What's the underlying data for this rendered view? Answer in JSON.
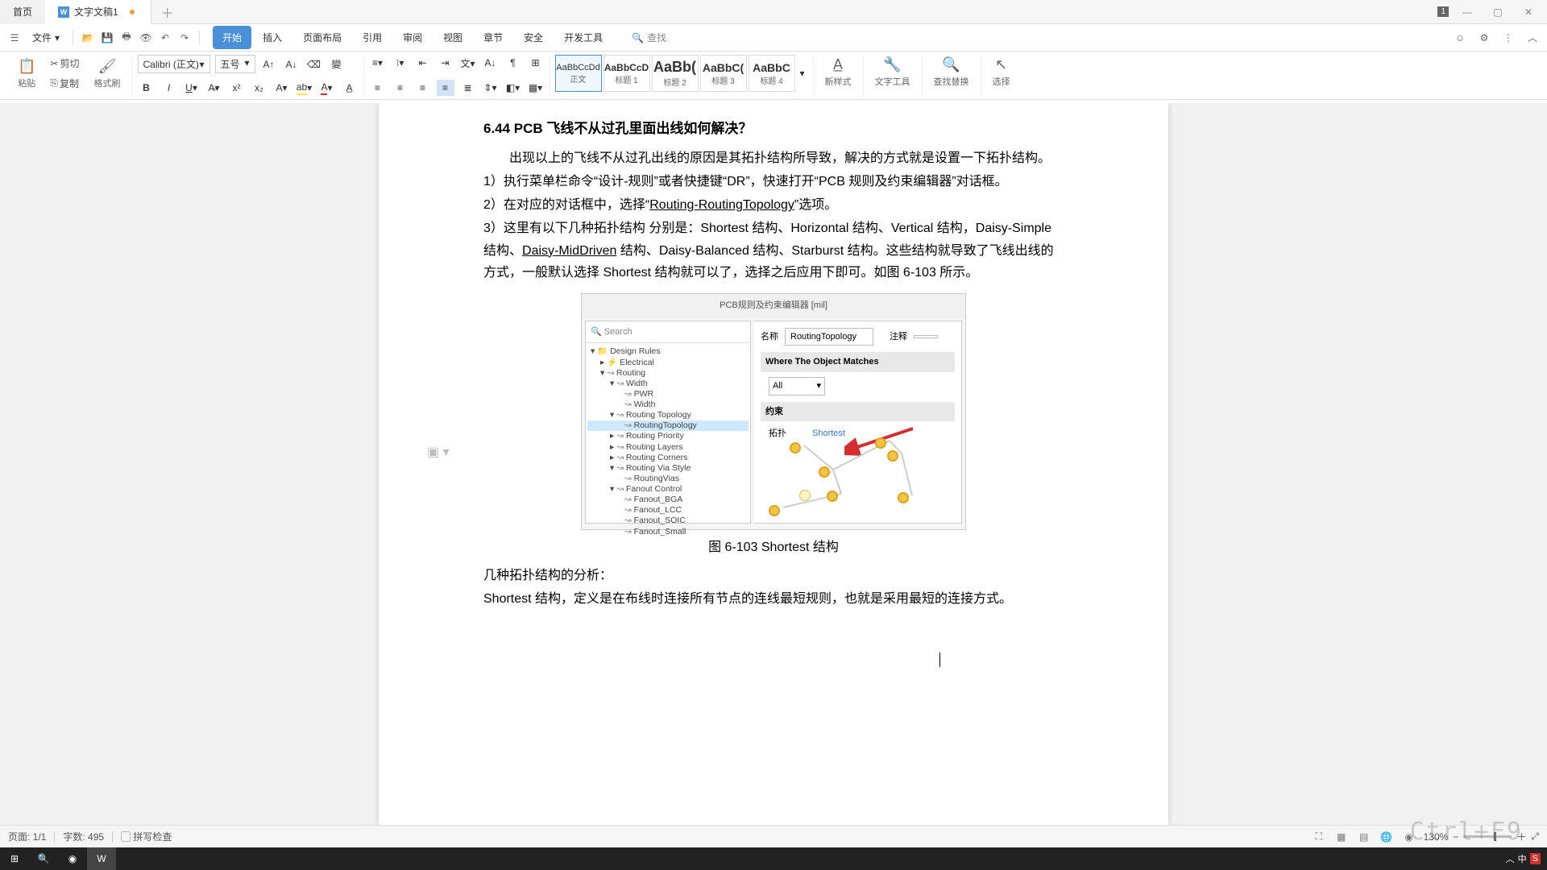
{
  "titlebar": {
    "home_tab": "首页",
    "doc_tab": "文字文稿1",
    "badge": "1"
  },
  "menubar": {
    "file": "文件",
    "tabs": [
      "开始",
      "插入",
      "页面布局",
      "引用",
      "审阅",
      "视图",
      "章节",
      "安全",
      "开发工具"
    ],
    "search": "查找"
  },
  "ribbon": {
    "paste": "粘贴",
    "cut": "剪切",
    "copy": "复制",
    "fmt_painter": "格式刷",
    "font_name": "Calibri (正文)",
    "font_size": "五号",
    "styles": [
      {
        "preview": "AaBbCcDd",
        "name": "正文"
      },
      {
        "preview": "AaBbCcD",
        "name": "标题 1"
      },
      {
        "preview": "AaBb(",
        "name": "标题 2"
      },
      {
        "preview": "AaBbC(",
        "name": "标题 3"
      },
      {
        "preview": "AaBbC",
        "name": "标题 4"
      }
    ],
    "new_style": "新样式",
    "text_tool": "文字工具",
    "find_rep": "查找替换",
    "select": "选择"
  },
  "doc": {
    "h": "6.44   PCB 飞线不从过孔里面出线如何解决？",
    "p1": "出现以上的飞线不从过孔出线的原因是其拓扑结构所导致，解决的方式就是设置一下拓扑结构。",
    "p2a": "1）执行菜单栏命令“设计-规则”或者快捷键“DR”，快速打开“PCB 规则及约束编辑器”对话框。",
    "p3a": "2）在对应的对话框中，选择“",
    "p3u": "Routing-RoutingTopology",
    "p3b": "”选项。",
    "p4a": "3）这里有以下几种拓扑结构  分别是：Shortest 结构、Horizontal 结构、Vertical 结构，Daisy-Simple 结构、",
    "p4u": "Daisy-MidDriven",
    "p4b": " 结构、Daisy-Balanced 结构、Starburst 结构。这些结构就导致了飞线出线的方式，一般默认选择 Shortest 结构就可以了，选择之后应用下即可。如图 6-103 所示。",
    "cap": "图 6-103 Shortest 结构",
    "p5": "几种拓扑结构的分析：",
    "p6": "Shortest 结构，定义是在布线时连接所有节点的连线最短规则，也就是采用最短的连接方式。"
  },
  "embedded": {
    "title": "PCB规则及约束编辑器 [mil]",
    "search": "Search",
    "name_lbl": "名称",
    "name_val": "RoutingTopology",
    "comment_lbl": "注释",
    "where": "Where The Object Matches",
    "all": "All",
    "cons": "约束",
    "topo_lbl": "拓扑",
    "topo_val": "Shortest",
    "tree": [
      {
        "lvl": 0,
        "exp": "▾",
        "ic": "📁",
        "t": "Design Rules"
      },
      {
        "lvl": 1,
        "exp": "▸",
        "ic": "⚡",
        "t": "Electrical"
      },
      {
        "lvl": 1,
        "exp": "▾",
        "ic": "↝",
        "t": "Routing"
      },
      {
        "lvl": 2,
        "exp": "▾",
        "ic": "↝",
        "t": "Width"
      },
      {
        "lvl": 3,
        "exp": "",
        "ic": "↝",
        "t": "PWR"
      },
      {
        "lvl": 3,
        "exp": "",
        "ic": "↝",
        "t": "Width"
      },
      {
        "lvl": 2,
        "exp": "▾",
        "ic": "↝",
        "t": "Routing Topology"
      },
      {
        "lvl": 3,
        "exp": "",
        "ic": "↝",
        "t": "RoutingTopology",
        "sel": true
      },
      {
        "lvl": 2,
        "exp": "▸",
        "ic": "↝",
        "t": "Routing Priority"
      },
      {
        "lvl": 2,
        "exp": "▸",
        "ic": "↝",
        "t": "Routing Layers"
      },
      {
        "lvl": 2,
        "exp": "▸",
        "ic": "↝",
        "t": "Routing Corners"
      },
      {
        "lvl": 2,
        "exp": "▾",
        "ic": "↝",
        "t": "Routing Via Style"
      },
      {
        "lvl": 3,
        "exp": "",
        "ic": "↝",
        "t": "RoutingVias"
      },
      {
        "lvl": 2,
        "exp": "▾",
        "ic": "↝",
        "t": "Fanout Control"
      },
      {
        "lvl": 3,
        "exp": "",
        "ic": "↝",
        "t": "Fanout_BGA"
      },
      {
        "lvl": 3,
        "exp": "",
        "ic": "↝",
        "t": "Fanout_LCC"
      },
      {
        "lvl": 3,
        "exp": "",
        "ic": "↝",
        "t": "Fanout_SOIC"
      },
      {
        "lvl": 3,
        "exp": "",
        "ic": "↝",
        "t": "Fanout_Small"
      }
    ]
  },
  "status": {
    "page": "页面: 1/1",
    "words": "字数: 495",
    "spell": "拼写检查",
    "zoom": "130%"
  },
  "hotkey": "Ctrl+F9",
  "tray": {
    "ime": "中"
  }
}
